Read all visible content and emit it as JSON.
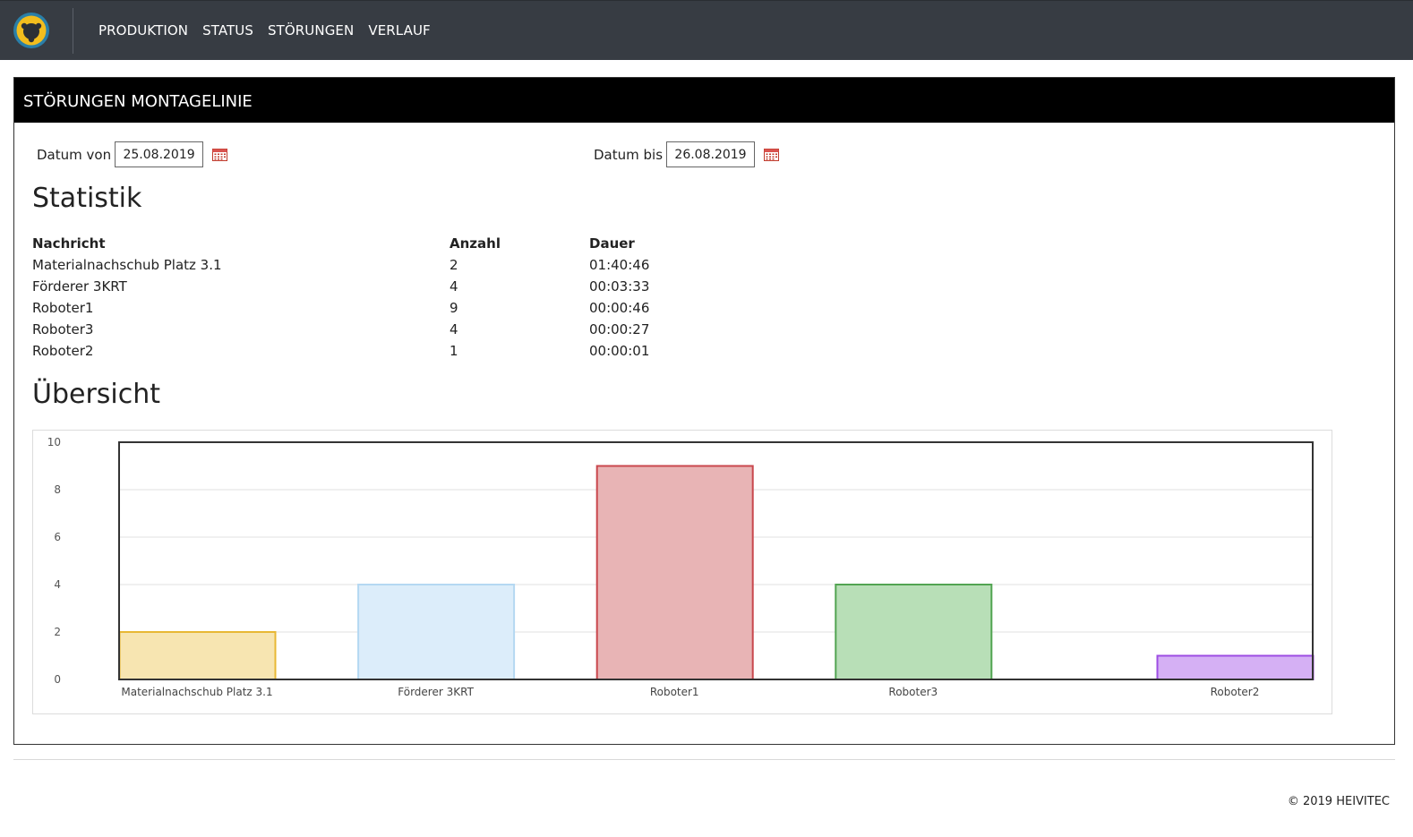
{
  "nav": {
    "items": [
      {
        "label": "PRODUKTION"
      },
      {
        "label": "STATUS"
      },
      {
        "label": "STÖRUNGEN"
      },
      {
        "label": "VERLAUF"
      }
    ]
  },
  "panel": {
    "title": "STÖRUNGEN MONTAGELINIE"
  },
  "filters": {
    "from_label": "Datum von",
    "from_value": "25.08.2019",
    "to_label": "Datum bis",
    "to_value": "26.08.2019"
  },
  "statistik": {
    "heading": "Statistik",
    "columns": [
      "Nachricht",
      "Anzahl",
      "Dauer"
    ],
    "rows": [
      {
        "nachricht": "Materialnachschub Platz 3.1",
        "anzahl": "2",
        "dauer": "01:40:46"
      },
      {
        "nachricht": "Förderer 3KRT",
        "anzahl": "4",
        "dauer": "00:03:33"
      },
      {
        "nachricht": "Roboter1",
        "anzahl": "9",
        "dauer": "00:00:46"
      },
      {
        "nachricht": "Roboter3",
        "anzahl": "4",
        "dauer": "00:00:27"
      },
      {
        "nachricht": "Roboter2",
        "anzahl": "1",
        "dauer": "00:00:01"
      }
    ]
  },
  "uebersicht": {
    "heading": "Übersicht"
  },
  "chart_data": {
    "type": "bar",
    "categories": [
      "Materialnachschub Platz 3.1",
      "Förderer 3KRT",
      "Roboter1",
      "Roboter3",
      "Roboter2"
    ],
    "values": [
      2,
      4,
      9,
      4,
      1
    ],
    "ylim": [
      0,
      10
    ],
    "yticks": [
      0,
      2,
      4,
      6,
      8,
      10
    ],
    "grid": true,
    "legend": "none",
    "colors": [
      {
        "fill": "#f7e5b1",
        "stroke": "#e8b834"
      },
      {
        "fill": "#dcedfa",
        "stroke": "#b4d8f2"
      },
      {
        "fill": "#e8b4b5",
        "stroke": "#c9474d"
      },
      {
        "fill": "#b8dfb7",
        "stroke": "#52a452"
      },
      {
        "fill": "#d5b0f4",
        "stroke": "#9d4de3"
      }
    ]
  },
  "footer": {
    "copyright": "© 2019 HEIVITEC"
  },
  "colors": {
    "topbar": "#373c43",
    "panel_header": "#000000"
  }
}
